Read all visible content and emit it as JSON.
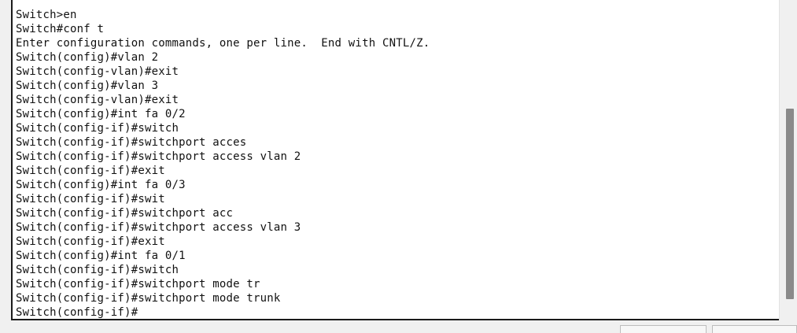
{
  "terminal": {
    "lines": [
      "Switch>en",
      "Switch#conf t",
      "Enter configuration commands, one per line.  End with CNTL/Z.",
      "Switch(config)#vlan 2",
      "Switch(config-vlan)#exit",
      "Switch(config)#vlan 3",
      "Switch(config-vlan)#exit",
      "Switch(config)#int fa 0/2",
      "Switch(config-if)#switch",
      "Switch(config-if)#switchport acces",
      "Switch(config-if)#switchport access vlan 2",
      "Switch(config-if)#exit",
      "Switch(config)#int fa 0/3",
      "Switch(config-if)#swit",
      "Switch(config-if)#switchport acc",
      "Switch(config-if)#switchport access vlan 3",
      "Switch(config-if)#exit",
      "Switch(config)#int fa 0/1",
      "Switch(config-if)#switch",
      "Switch(config-if)#switchport mode tr",
      "Switch(config-if)#switchport mode trunk",
      "Switch(config-if)#"
    ]
  }
}
